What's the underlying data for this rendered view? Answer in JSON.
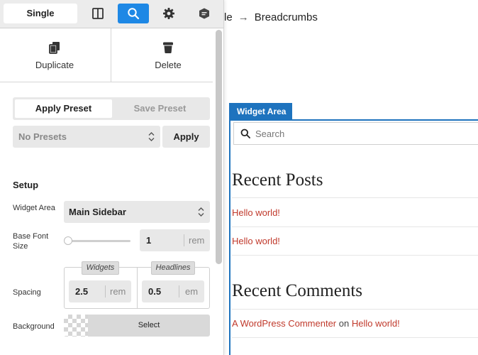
{
  "colors": {
    "accent": "#1e88e5",
    "widget_area": "#1e73be",
    "link": "#c0392b"
  },
  "toolbar": {
    "mode_label": "Single",
    "icons": [
      "columns-icon",
      "search-icon",
      "gear-icon",
      "shield-chat-icon"
    ]
  },
  "actions": {
    "duplicate_label": "Duplicate",
    "delete_label": "Delete"
  },
  "presets": {
    "apply_tab_label": "Apply Preset",
    "save_tab_label": "Save Preset",
    "select_value": "No Presets",
    "apply_button_label": "Apply"
  },
  "setup": {
    "heading": "Setup",
    "widget_area": {
      "label": "Widget Area",
      "value": "Main Sidebar"
    },
    "base_font_size": {
      "label": "Base Font Size",
      "value": "1",
      "unit": "rem",
      "slider_fraction": 0.0
    },
    "spacing": {
      "label": "Spacing",
      "widgets": {
        "tag": "Widgets",
        "value": "2.5",
        "unit": "rem"
      },
      "headlines": {
        "tag": "Headlines",
        "value": "0.5",
        "unit": "em"
      }
    },
    "background": {
      "label": "Background",
      "button_label": "Select"
    }
  },
  "preview": {
    "breadcrumb_prefix": "le",
    "breadcrumb_arrow": "→",
    "breadcrumb_current": "Breadcrumbs",
    "widget_area_tab": "Widget Area",
    "search_placeholder": "Search",
    "recent_posts_title": "Recent Posts",
    "recent_posts": [
      "Hello world!",
      "Hello world!"
    ],
    "recent_comments_title": "Recent Comments",
    "comment_author": "A WordPress Commenter",
    "comment_on": "on",
    "comment_post": "Hello world!"
  }
}
